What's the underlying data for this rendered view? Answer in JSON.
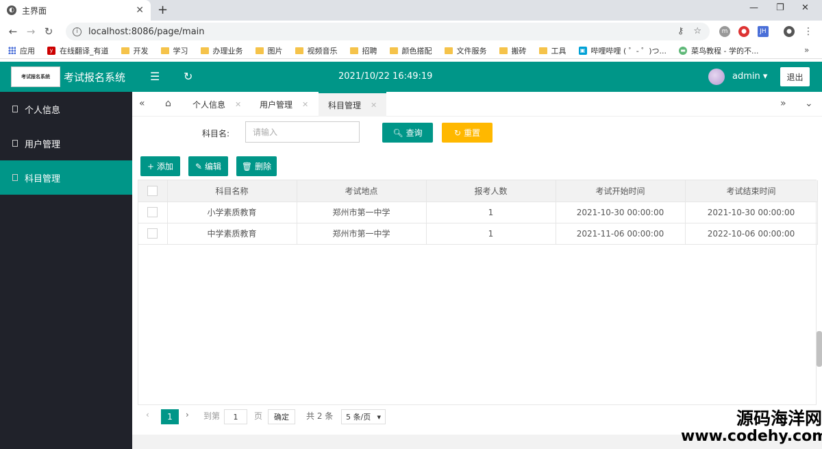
{
  "browser": {
    "tab_title": "主界面",
    "url": "localhost:8086/page/main",
    "bookmarks": [
      "应用",
      "在线翻译_有道",
      "开发",
      "学习",
      "办理业务",
      "图片",
      "视频音乐",
      "招聘",
      "颜色搭配",
      "文件服务",
      "搬砖",
      "工具",
      "哔哩哔哩 ( ゜- ゜)つ...",
      "菜鸟教程 - 学的不..."
    ]
  },
  "header": {
    "logo_text": "考试报名系统",
    "title": "考试报名系统",
    "datetime": "2021/10/22 16:49:19",
    "username": "admin",
    "logout_label": "退出"
  },
  "sidebar": {
    "items": [
      {
        "label": "个人信息"
      },
      {
        "label": "用户管理"
      },
      {
        "label": "科目管理",
        "active": true
      }
    ]
  },
  "tabs": [
    {
      "label": "个人信息"
    },
    {
      "label": "用户管理"
    },
    {
      "label": "科目管理",
      "active": true
    }
  ],
  "search": {
    "label": "科目名:",
    "placeholder": "请输入",
    "query_label": "查询",
    "reset_label": "重置"
  },
  "toolbar": {
    "add_label": "添加",
    "edit_label": "编辑",
    "delete_label": "删除"
  },
  "table": {
    "columns": [
      "科目名称",
      "考试地点",
      "报考人数",
      "考试开始时间",
      "考试结束时间"
    ],
    "rows": [
      [
        "小学素质教育",
        "郑州市第一中学",
        "1",
        "2021-10-30 00:00:00",
        "2021-10-30 00:00:00"
      ],
      [
        "中学素质教育",
        "郑州市第一中学",
        "1",
        "2021-11-06 00:00:00",
        "2022-10-06 00:00:00"
      ]
    ]
  },
  "pager": {
    "current_page": "1",
    "goto_label": "到第",
    "goto_value": "1",
    "page_unit": "页",
    "confirm_label": "确定",
    "total_label": "共 2 条",
    "page_size_label": "5 条/页"
  },
  "watermark": {
    "line1": "源码海洋网",
    "line2": "www.codehy.com"
  },
  "colors": {
    "primary": "#009688",
    "warn": "#ffb800",
    "sidebar_bg": "#20222a"
  }
}
